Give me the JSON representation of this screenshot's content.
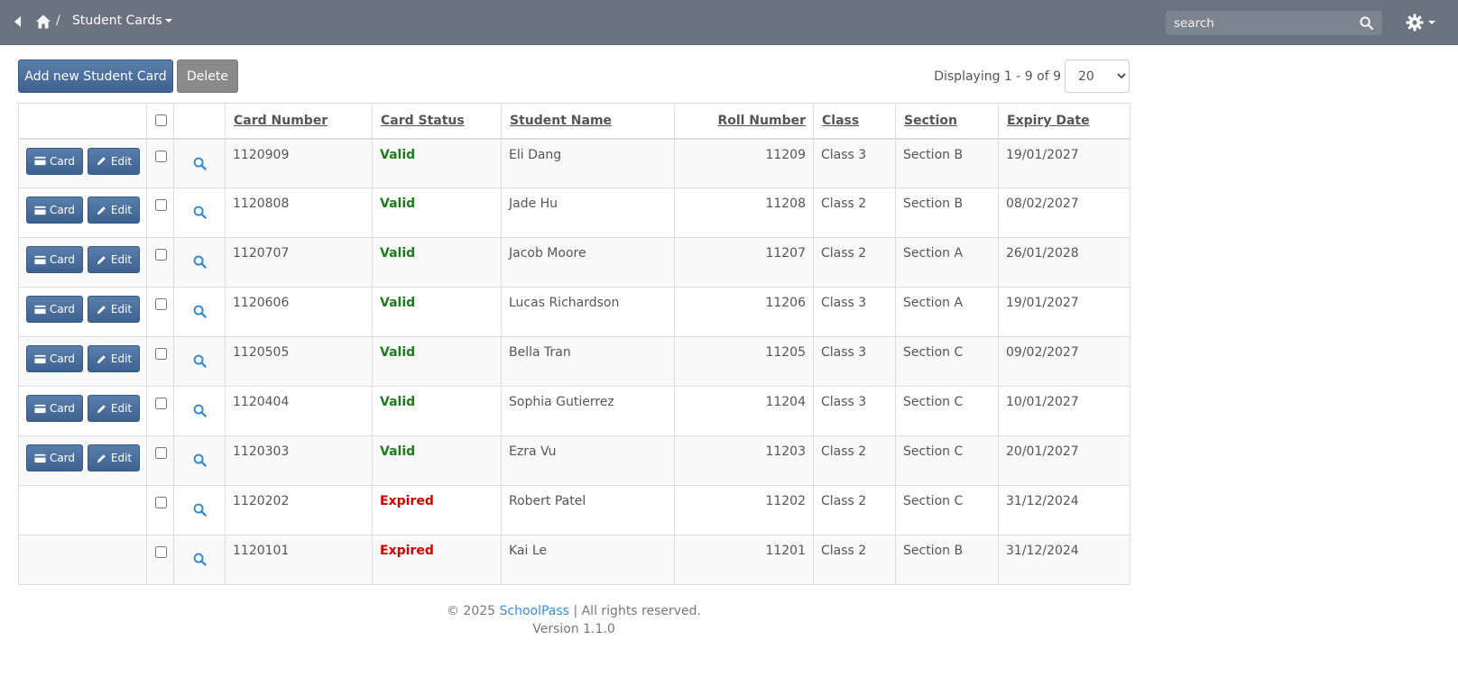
{
  "navbar": {
    "breadcrumb_sep": "/",
    "title": "Student Cards",
    "search_placeholder": "search",
    "background": "#6b7380"
  },
  "toolbar": {
    "add_label": "Add new Student Card",
    "delete_label": "Delete",
    "displaying": "Displaying 1 - 9 of 9",
    "page_size": "20",
    "page_size_options": [
      "20"
    ]
  },
  "table": {
    "columns": {
      "card_number": "Card Number",
      "card_status": "Card Status",
      "student_name": "Student Name",
      "roll_number": "Roll Number",
      "class": "Class",
      "section": "Section",
      "expiry_date": "Expiry Date"
    },
    "card_button_label": "Card",
    "edit_button_label": "Edit",
    "rows": [
      {
        "card_number": "1120909",
        "status": "Valid",
        "name": "Eli Dang",
        "roll": "11209",
        "class": "Class 3",
        "section": "Section B",
        "expiry": "19/01/2027",
        "actions": true
      },
      {
        "card_number": "1120808",
        "status": "Valid",
        "name": "Jade Hu",
        "roll": "11208",
        "class": "Class 2",
        "section": "Section B",
        "expiry": "08/02/2027",
        "actions": true
      },
      {
        "card_number": "1120707",
        "status": "Valid",
        "name": "Jacob Moore",
        "roll": "11207",
        "class": "Class 2",
        "section": "Section A",
        "expiry": "26/01/2028",
        "actions": true
      },
      {
        "card_number": "1120606",
        "status": "Valid",
        "name": "Lucas Richardson",
        "roll": "11206",
        "class": "Class 3",
        "section": "Section A",
        "expiry": "19/01/2027",
        "actions": true
      },
      {
        "card_number": "1120505",
        "status": "Valid",
        "name": "Bella Tran",
        "roll": "11205",
        "class": "Class 3",
        "section": "Section C",
        "expiry": "09/02/2027",
        "actions": true
      },
      {
        "card_number": "1120404",
        "status": "Valid",
        "name": "Sophia Gutierrez",
        "roll": "11204",
        "class": "Class 3",
        "section": "Section C",
        "expiry": "10/01/2027",
        "actions": true
      },
      {
        "card_number": "1120303",
        "status": "Valid",
        "name": "Ezra Vu",
        "roll": "11203",
        "class": "Class 2",
        "section": "Section C",
        "expiry": "20/01/2027",
        "actions": true
      },
      {
        "card_number": "1120202",
        "status": "Expired",
        "name": "Robert Patel",
        "roll": "11202",
        "class": "Class 2",
        "section": "Section C",
        "expiry": "31/12/2024",
        "actions": false
      },
      {
        "card_number": "1120101",
        "status": "Expired",
        "name": "Kai Le",
        "roll": "11201",
        "class": "Class 2",
        "section": "Section B",
        "expiry": "31/12/2024",
        "actions": false
      }
    ]
  },
  "footer": {
    "copyright_prefix": "© 2025",
    "brand": "SchoolPass",
    "copyright_suffix": "| All rights reserved.",
    "version": "Version 1.1.0"
  },
  "colors": {
    "primary_button": "#4a6f9c",
    "valid": "#1e7a1e",
    "expired": "#d40000",
    "link": "#3d8ad6"
  }
}
